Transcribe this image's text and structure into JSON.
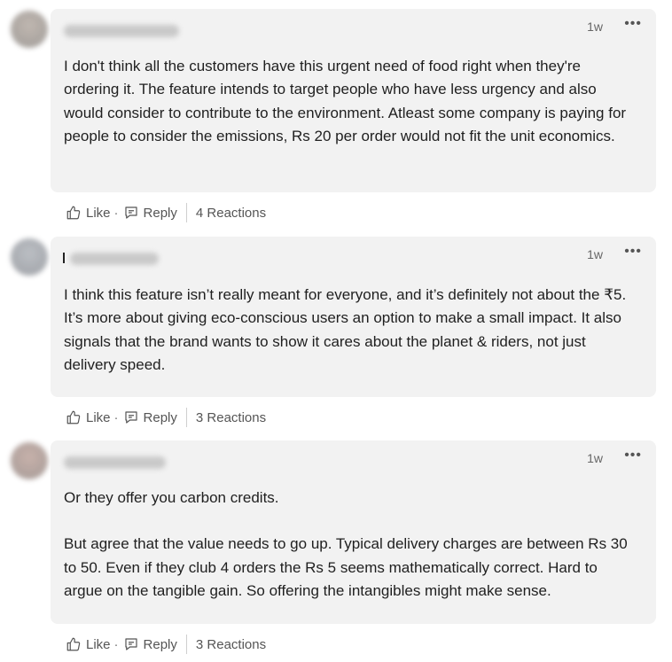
{
  "comments": [
    {
      "time": "1w",
      "more": "•••",
      "paragraphs": [
        "I don't think all the customers have this urgent need of food right when they're ordering it. The feature intends to target people who have less urgency and also would consider to contribute to the environment. Atleast some company is paying for people to consider the emissions, Rs 20 per order would not fit the unit economics."
      ],
      "like_label": "Like",
      "reply_label": "Reply",
      "reactions": "4 Reactions",
      "avatar_color": "#a09890"
    },
    {
      "time": "1w",
      "more": "•••",
      "paragraphs": [
        "I think this feature isn’t really meant for everyone, and it’s definitely not about the ₹5. It’s more about giving eco-conscious users an option to make a small impact. It also signals that the brand wants to show it cares about the planet & riders, not just delivery speed."
      ],
      "like_label": "Like",
      "reply_label": "Reply",
      "reactions": "3 Reactions",
      "avatar_color": "#9a9fa6"
    },
    {
      "time": "1w",
      "more": "•••",
      "paragraphs": [
        "Or they offer you carbon credits.",
        "But agree that the value needs to go up. Typical delivery charges are between Rs 30 to 50. Even if they club 4 orders the Rs 5 seems mathematically correct. Hard to argue on the tangible gain. So offering the intangibles might make sense."
      ],
      "like_label": "Like",
      "reply_label": "Reply",
      "reactions": "3 Reactions",
      "avatar_color": "#a8948e"
    }
  ]
}
